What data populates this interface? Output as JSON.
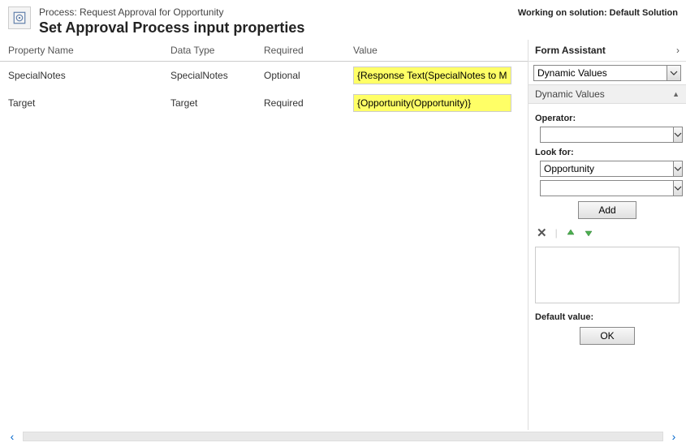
{
  "header": {
    "process_prefix": "Process: ",
    "process_name": "Request Approval for Opportunity",
    "title": "Set Approval Process input properties",
    "working_prefix": "Working on solution: ",
    "working_solution": "Default Solution"
  },
  "table": {
    "columns": {
      "name": "Property Name",
      "type": "Data Type",
      "required": "Required",
      "value": "Value"
    },
    "rows": [
      {
        "name": "SpecialNotes",
        "type": "SpecialNotes",
        "required": "Optional",
        "value": "{Response Text(SpecialNotes to Manager)}"
      },
      {
        "name": "Target",
        "type": "Target",
        "required": "Required",
        "value": "{Opportunity(Opportunity)}"
      }
    ]
  },
  "form_assistant": {
    "title": "Form Assistant",
    "dropdown_value": "Dynamic Values",
    "section_title": "Dynamic Values",
    "operator_label": "Operator:",
    "operator_value": "",
    "look_for_label": "Look for:",
    "look_for_value": "Opportunity",
    "look_for_sub_value": "",
    "add_label": "Add",
    "default_label": "Default value:",
    "default_value": "",
    "ok_label": "OK"
  }
}
